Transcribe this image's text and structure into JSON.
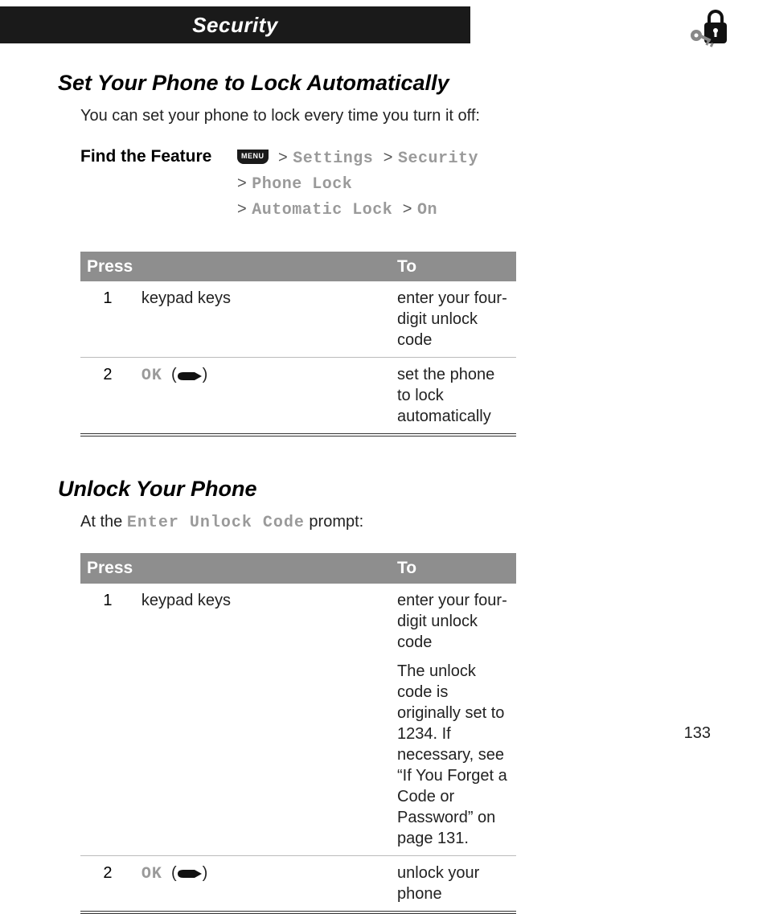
{
  "header": {
    "title": "Security"
  },
  "pageNumber": "133",
  "featureLabel": "Find the Feature",
  "menuKey": "MENU",
  "section1": {
    "heading": "Set Your Phone to Lock Automatically",
    "intro": "You can set your phone to lock every time you turn it off:",
    "path": {
      "l1a": "Settings",
      "l1b": "Security",
      "l2": "Phone Lock",
      "l3a": "Automatic Lock",
      "l3b": "On"
    },
    "table": {
      "h1": "Press",
      "h2": "To",
      "rows": [
        {
          "n": "1",
          "press": "keypad keys",
          "to": "enter your four-digit unlock code"
        },
        {
          "n": "2",
          "pressOk": "OK",
          "to": "set the phone to lock automatically"
        }
      ]
    }
  },
  "section2": {
    "heading": "Unlock Your Phone",
    "introPre": "At the ",
    "introCode": "Enter Unlock Code",
    "introPost": " prompt:",
    "table": {
      "h1": "Press",
      "h2": "To",
      "rows": [
        {
          "n": "1",
          "press": "keypad keys",
          "to": "enter your four-digit unlock code",
          "note": "The unlock code is originally set to 1234. If necessary, see “If You Forget a Code or Password” on page 131."
        },
        {
          "n": "2",
          "pressOk": "OK",
          "to": "unlock your phone"
        }
      ]
    }
  }
}
